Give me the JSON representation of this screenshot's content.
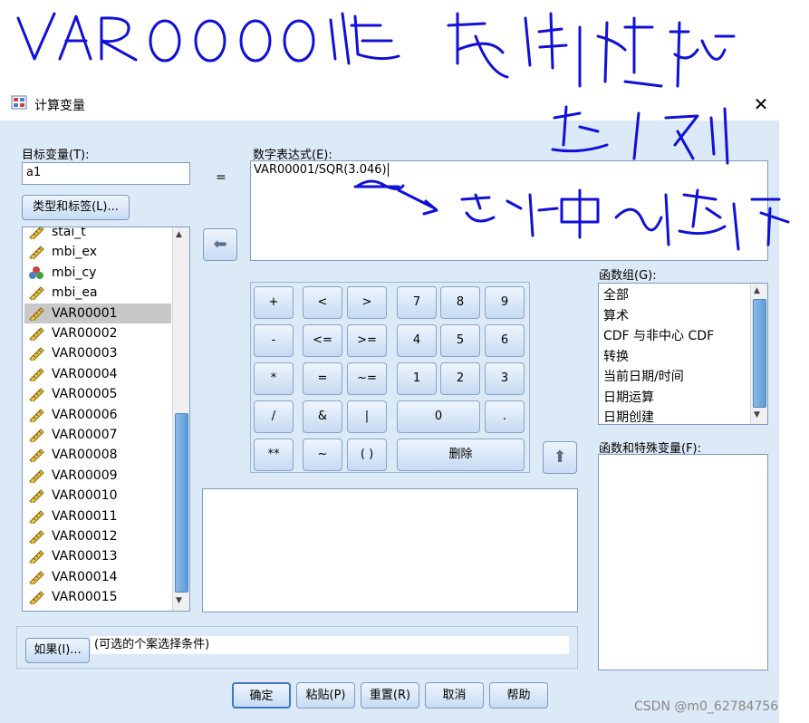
{
  "window": {
    "title": "计算变量",
    "close_glyph": "✕"
  },
  "target": {
    "label": "目标变量(T):",
    "value": "a1",
    "equals": "="
  },
  "type_label_button": "类型和标签(L)...",
  "expression": {
    "label": "数字表达式(E):",
    "value": "VAR00001/SQR(3.046)"
  },
  "variables": [
    {
      "name": "stai_t",
      "type": "scale"
    },
    {
      "name": "mbi_ex",
      "type": "scale"
    },
    {
      "name": "mbi_cy",
      "type": "nominal"
    },
    {
      "name": "mbi_ea",
      "type": "scale"
    },
    {
      "name": "VAR00001",
      "type": "scale",
      "selected": true
    },
    {
      "name": "VAR00002",
      "type": "scale"
    },
    {
      "name": "VAR00003",
      "type": "scale"
    },
    {
      "name": "VAR00004",
      "type": "scale"
    },
    {
      "name": "VAR00005",
      "type": "scale"
    },
    {
      "name": "VAR00006",
      "type": "scale"
    },
    {
      "name": "VAR00007",
      "type": "scale"
    },
    {
      "name": "VAR00008",
      "type": "scale"
    },
    {
      "name": "VAR00009",
      "type": "scale"
    },
    {
      "name": "VAR00010",
      "type": "scale"
    },
    {
      "name": "VAR00011",
      "type": "scale"
    },
    {
      "name": "VAR00012",
      "type": "scale"
    },
    {
      "name": "VAR00013",
      "type": "scale"
    },
    {
      "name": "VAR00014",
      "type": "scale"
    },
    {
      "name": "VAR00015",
      "type": "scale"
    }
  ],
  "keypad": {
    "plus": "+",
    "lt": "<",
    "gt": ">",
    "d7": "7",
    "d8": "8",
    "d9": "9",
    "minus": "-",
    "le": "<=",
    "ge": ">=",
    "d4": "4",
    "d5": "5",
    "d6": "6",
    "mul": "*",
    "eq": "=",
    "ne": "~=",
    "d1": "1",
    "d2": "2",
    "d3": "3",
    "div": "/",
    "and": "&",
    "or": "|",
    "d0": "0",
    "dot": ".",
    "pow": "**",
    "not": "~",
    "paren": "( )",
    "delete": "删除"
  },
  "function_group": {
    "label": "函数组(G):",
    "items": [
      "全部",
      "算术",
      "CDF 与非中心 CDF",
      "转换",
      "当前日期/时间",
      "日期运算",
      "日期创建"
    ]
  },
  "functions_label": "函数和特殊变量(F):",
  "if_button": "如果(I)...",
  "if_text": "(可选的个案选择条件)",
  "buttons": {
    "ok": "确定",
    "paste": "粘贴(P)",
    "reset": "重置(R)",
    "cancel": "取消",
    "help": "帮助"
  },
  "watermark": "CSDN @m0_62784756",
  "annotations": [
    "VAR00001是复制过去的",
    "第1列",
    "总计中的第1行"
  ],
  "colors": {
    "handwriting": "#1010d8",
    "selection": "#c8c8c8",
    "dialog_bg": "#dce9f6"
  }
}
